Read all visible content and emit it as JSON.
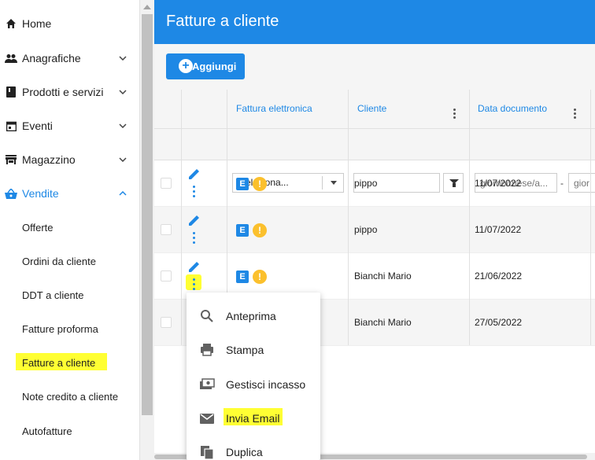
{
  "sidebar": {
    "items": [
      {
        "label": "Home",
        "icon": "home-icon"
      },
      {
        "label": "Anagrafiche",
        "icon": "people-icon"
      },
      {
        "label": "Prodotti e servizi",
        "icon": "book-icon"
      },
      {
        "label": "Eventi",
        "icon": "calendar-icon"
      },
      {
        "label": "Magazzino",
        "icon": "store-icon"
      },
      {
        "label": "Vendite",
        "icon": "basket-icon"
      }
    ],
    "vendite_sub": [
      "Offerte",
      "Ordini da cliente",
      "DDT a cliente",
      "Fatture proforma",
      "Fatture a cliente",
      "Note credito a cliente",
      "Autofatture"
    ]
  },
  "header": {
    "title": "Fatture a cliente"
  },
  "toolbar": {
    "add_label": "Aggiungi"
  },
  "grid": {
    "columns": [
      "Fattura elettronica",
      "Cliente",
      "Data documento"
    ],
    "filters": {
      "select_value": "Seleziona...",
      "date_placeholder": "giorno/mese/a...",
      "date_to_placeholder": "gior",
      "range_sep": "-"
    },
    "rows": [
      {
        "badge": "E",
        "warn": "!",
        "cliente": "pippo",
        "data": "11/07/2022"
      },
      {
        "badge": "E",
        "warn": "!",
        "cliente": "pippo",
        "data": "11/07/2022"
      },
      {
        "badge": "E",
        "warn": "!",
        "cliente": "Bianchi Mario",
        "data": "21/06/2022"
      },
      {
        "badge": "E",
        "warn": "!",
        "cliente": "Bianchi Mario",
        "data": "27/05/2022"
      }
    ]
  },
  "context_menu": {
    "items": [
      {
        "label": "Anteprima",
        "icon": "search-icon"
      },
      {
        "label": "Stampa",
        "icon": "print-icon"
      },
      {
        "label": "Gestisci incasso",
        "icon": "payment-icon"
      },
      {
        "label": "Invia Email",
        "icon": "email-icon"
      },
      {
        "label": "Duplica",
        "icon": "copy-icon"
      }
    ]
  },
  "colors": {
    "accent": "#1e88e5",
    "highlight": "#ffff33",
    "warning": "#fbc02d"
  }
}
